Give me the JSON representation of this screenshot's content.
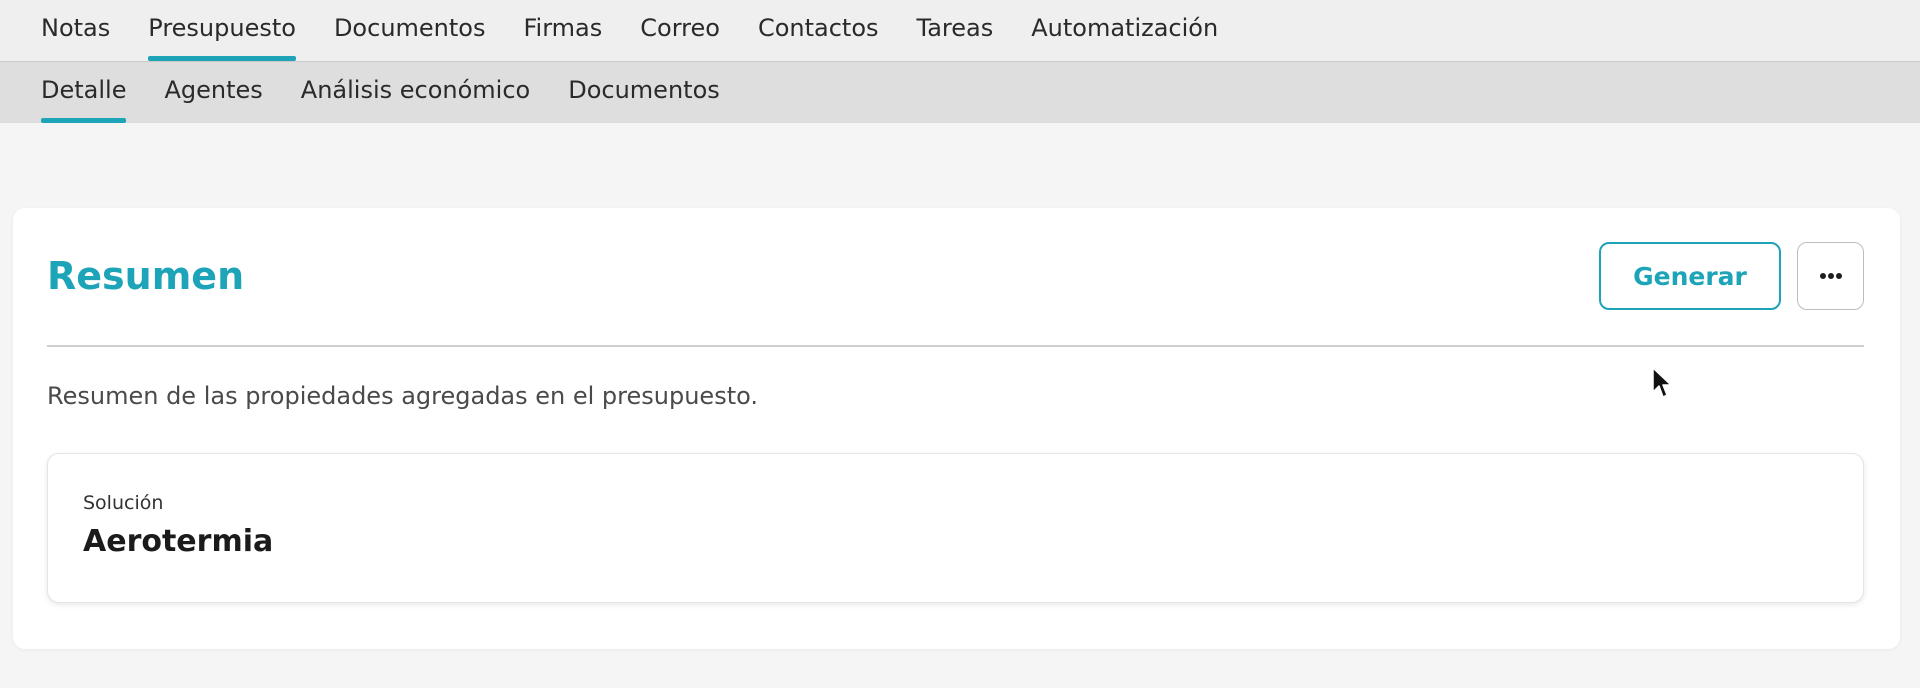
{
  "primary_tabs": [
    {
      "label": "Notas",
      "active": false
    },
    {
      "label": "Presupuesto",
      "active": true
    },
    {
      "label": "Documentos",
      "active": false
    },
    {
      "label": "Firmas",
      "active": false
    },
    {
      "label": "Correo",
      "active": false
    },
    {
      "label": "Contactos",
      "active": false
    },
    {
      "label": "Tareas",
      "active": false
    },
    {
      "label": "Automatización",
      "active": false
    }
  ],
  "secondary_tabs": [
    {
      "label": "Detalle",
      "active": true
    },
    {
      "label": "Agentes",
      "active": false
    },
    {
      "label": "Análisis económico",
      "active": false
    },
    {
      "label": "Documentos",
      "active": false
    }
  ],
  "summary": {
    "title": "Resumen",
    "generate_label": "Generar",
    "more_icon": "ellipsis-icon",
    "description": "Resumen de las propiedades agregadas en el presupuesto.",
    "field": {
      "label": "Solución",
      "value": "Aerotermia"
    }
  },
  "colors": {
    "accent": "#1ea4b8",
    "background": "#f5f5f5",
    "primary_tabs_bg": "#efefef",
    "secondary_tabs_bg": "#dedede"
  }
}
